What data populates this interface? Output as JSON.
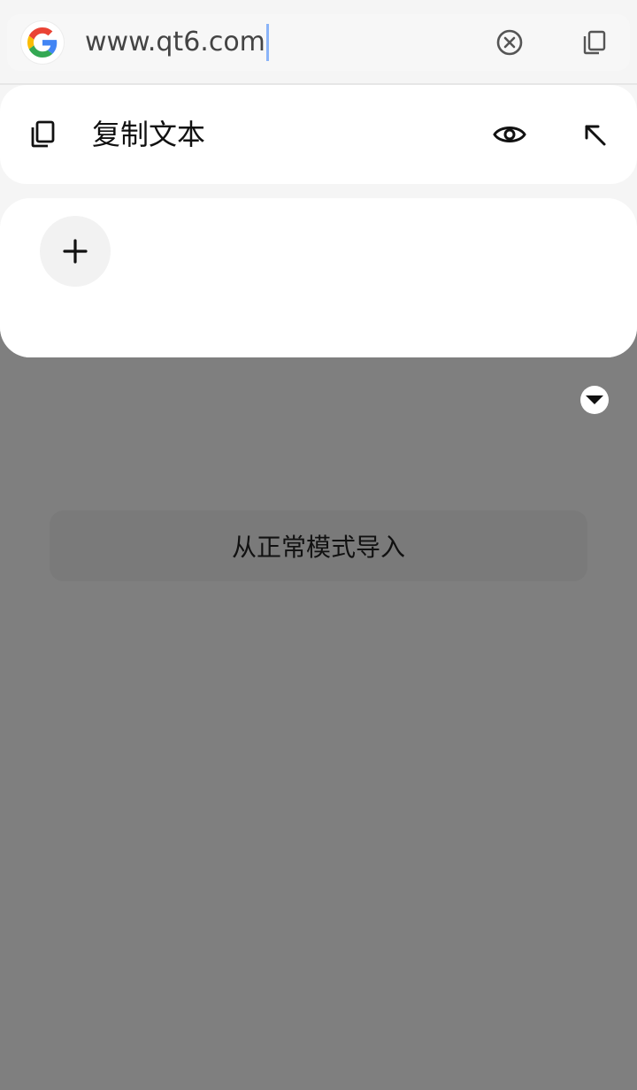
{
  "address_bar": {
    "engine_icon": "google-g-icon",
    "url": "www.qt6.com",
    "clear_icon": "clear-circle-x-icon",
    "copy_icon": "copy-icon"
  },
  "copy_card": {
    "copy_icon": "copy-icon",
    "label": "复制文本",
    "preview_icon": "eye-icon",
    "insert_icon": "arrow-up-left-icon"
  },
  "add_card": {
    "add_icon": "plus-icon"
  },
  "collapse_icon": "caret-down-circle-icon",
  "import_button": {
    "label": "从正常模式导入"
  },
  "colors": {
    "overlay": "#7f7f7f",
    "panel": "#f5f5f5",
    "card": "#ffffff",
    "caret": "#8ab4f8",
    "google_blue": "#4285F4",
    "google_red": "#EA4335",
    "google_yellow": "#FBBC05",
    "google_green": "#34A853"
  }
}
